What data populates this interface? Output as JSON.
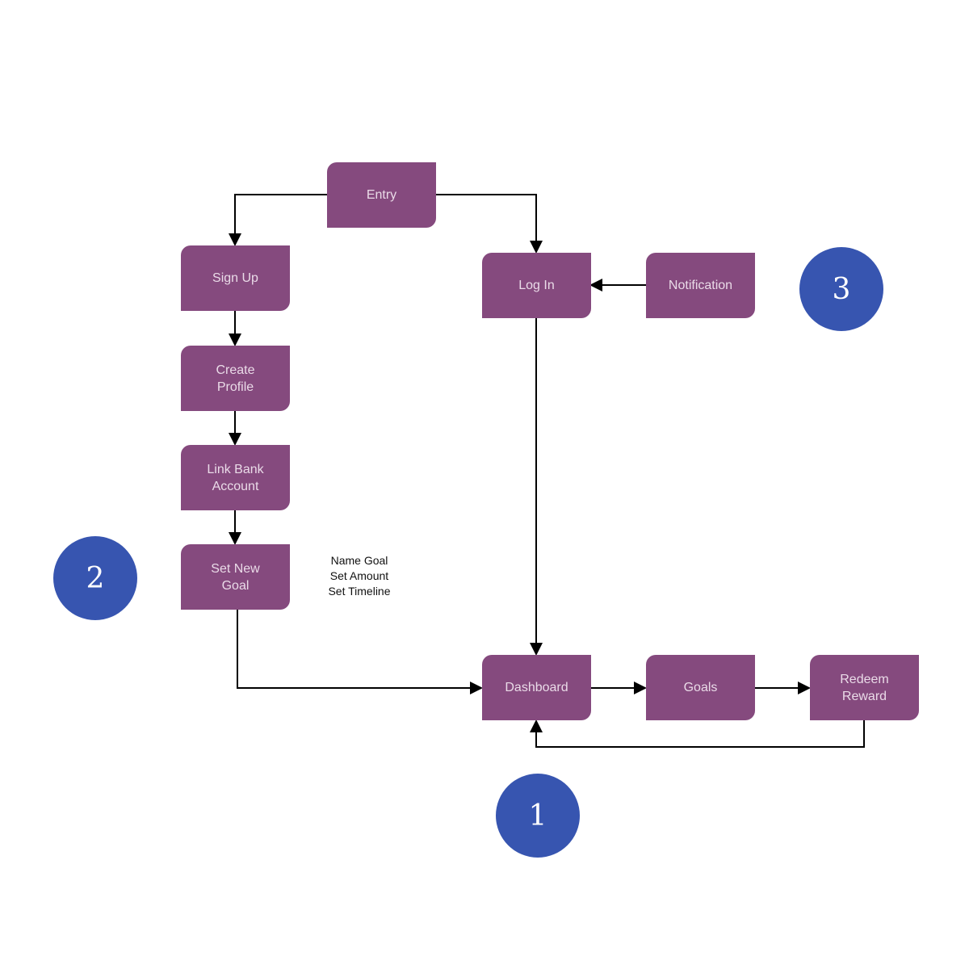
{
  "colors": {
    "node": "#854a7e",
    "badge": "#3755b0",
    "edge": "#000000"
  },
  "nodes": {
    "entry": "Entry",
    "sign_up": "Sign Up",
    "create_profile": "Create\nProfile",
    "link_bank": "Link Bank\nAccount",
    "set_goal": "Set New\nGoal",
    "log_in": "Log In",
    "notification": "Notification",
    "dashboard": "Dashboard",
    "goals": "Goals",
    "redeem": "Redeem\nReward"
  },
  "note": [
    "Name Goal",
    "Set Amount",
    "Set Timeline"
  ],
  "badges": {
    "one": "1",
    "two": "2",
    "three": "3"
  }
}
